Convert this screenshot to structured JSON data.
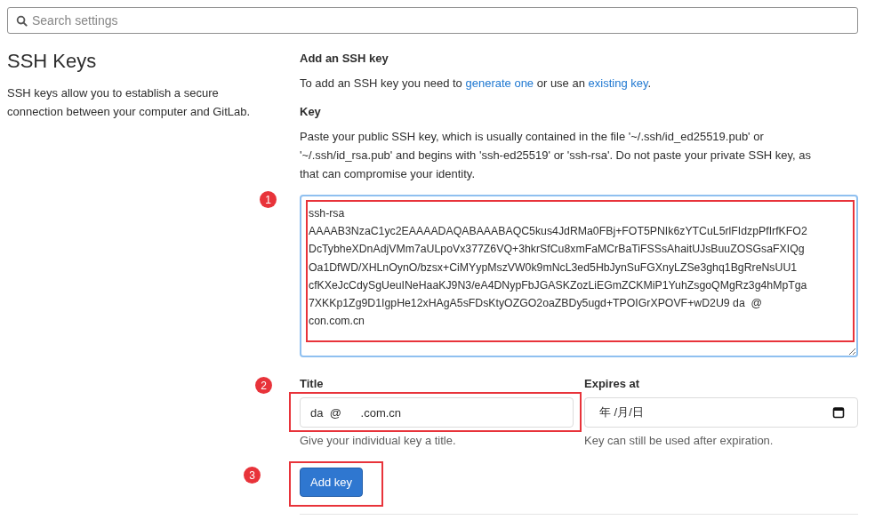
{
  "search": {
    "placeholder": "Search settings"
  },
  "section": {
    "title": "SSH Keys",
    "description": "SSH keys allow you to establish a secure connection between your computer and GitLab."
  },
  "form": {
    "heading": "Add an SSH key",
    "intro": {
      "before": "To add an SSH key you need to ",
      "link_1": "generate one",
      "middle": " or use an ",
      "link_2": "existing key",
      "after": "."
    },
    "key": {
      "label": "Key",
      "help": "Paste your public SSH key, which is usually contained in the file '~/.ssh/id_ed25519.pub' or '~/.ssh/id_rsa.pub' and begins with 'ssh-ed25519' or 'ssh-rsa'. Do not paste your private SSH key, as that can compromise your identity.",
      "value_lines": [
        "ssh-rsa",
        "AAAAB3NzaC1yc2EAAAADAQABAAABAQC5kus4JdRMa0FBj+FOT5PNIk6zYTCuL5rlFIdzpPfIrfKFO2",
        "DcTybheXDnAdjVMm7aULpoVx377Z6VQ+3hkrSfCu8xmFaMCrBaTiFSSsAhaitUJsBuuZOSGsaFXIQg",
        "Oa1DfWD/XHLnOynO/bzsx+CiMYypMszVW0k9mNcL3ed5HbJynSuFGXnyLZSe3ghq1BgRreNsUU1",
        "cfKXeJcCdySgUeuINeHaaKJ9N3/eA4DNypFbJGASKZozLiEGmZCKMiP1YuhZsgoQMgRz3g4hMpTga",
        "7XKKp1Zg9D1IgpHe12xHAgA5sFDsKtyOZGO2oaZBDy5ugd+TPOIGrXPOVF+wD2U9 da  @",
        "con.com.cn"
      ]
    },
    "title": {
      "label": "Title",
      "value": "da  @      .com.cn",
      "help": "Give your individual key a title."
    },
    "expires": {
      "label": "Expires at",
      "value": "年 /月/日",
      "help": "Key can still be used after expiration."
    },
    "submit": "Add key"
  },
  "annotations": [
    "1",
    "2",
    "3"
  ]
}
